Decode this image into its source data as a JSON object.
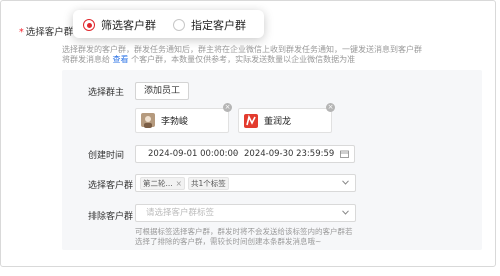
{
  "field": {
    "label": "选择客户群",
    "required_mark": "*"
  },
  "mode": {
    "options": [
      {
        "label": "筛选客户群",
        "selected": true
      },
      {
        "label": "指定客户群",
        "selected": false
      }
    ]
  },
  "hint": {
    "line1": "选择群发的客户群，群发任务通知后，群主将在企业微信上收到群发任务通知，一键发送消息到客户群",
    "line2_prefix": "将群发消息给",
    "line2_link": "查看",
    "line2_suffix": "个客户群，本数量仅供参考，实际发送数量以企业微信数据为准"
  },
  "owner": {
    "label": "选择群主",
    "add_button": "添加员工",
    "members": [
      {
        "name": "李勃峻",
        "avatar_color": "#b59a7e"
      },
      {
        "name": "董润龙",
        "avatar_color": "#e33b2e"
      }
    ]
  },
  "created_time": {
    "label": "创建时间",
    "start": "2024-09-01 00:00:00",
    "separator": "~",
    "end": "2024-09-30 23:59:59"
  },
  "include_groups": {
    "label": "选择客户群",
    "tags": [
      "第二轮...",
      "共1个标签"
    ]
  },
  "exclude_groups": {
    "label": "排除客户群",
    "placeholder": "请选择客户群标签"
  },
  "bottom_hint": {
    "line1": "可根据标签选择客户群，群发时将不会发送给该标签内的客户群若",
    "line2": "选择了排除的客户群，需较长时间创建本条群发消息哦~"
  },
  "colors": {
    "accent": "#e0282e",
    "link": "#2b73e6"
  }
}
